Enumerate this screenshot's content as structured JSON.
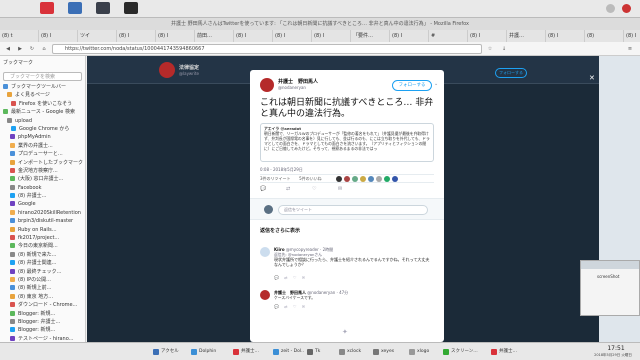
{
  "window": {
    "title": "井護士 野田馬人さんはTwitterを使っています: 「これは朝日新聞に抗議すべきところ… 非弁と真ん中の違法行為」 - Mozilla Firefox"
  },
  "tabs": [
    "(8) t",
    "(8) I",
    "ツイ",
    "(8) I",
    "(8) I",
    "前田…",
    "(8) I",
    "(8) I",
    "(8) I",
    "「要件…",
    "(8) I",
    "#",
    "(8) I",
    "井護…",
    "(8) I",
    "(8)",
    "(8) I",
    "(8) I",
    "Shor",
    "then",
    "(8) I"
  ],
  "url": "https://twitter.com/noda/status/1000441743594860667",
  "sidebar": {
    "title": "ブックマーク",
    "search_placeholder": "ブックマークを検索",
    "items": [
      "ブックマークツールバー",
      "よく見るページ",
      "Firefox を使いこなそう",
      "最新ニュース - Google 検索",
      "upload",
      "Google Chrome から",
      "phpMyAdmin",
      "業界の弁護士...",
      "プロデューサーと...",
      "インポートしたブックマーク",
      "金沢地方検察庁...",
      "(大阪) 窓口弁護士...",
      "Facebook",
      "(8) 弁護士...",
      "Google",
      "hirano2020SkillRetention",
      "brpin3/diskutil-master",
      "Ruby on Rails...",
      "fk2017/project...",
      "今日の東京新聞...",
      "(8) 新規で来た...",
      "(8) 弁護士関連...",
      "(8) 最終チェック...",
      "(8) IPの公開...",
      "(8) 新規上前...",
      "(8) 東京 地方...",
      "ダウンロード - Chrome...",
      "Blogger: 新規...",
      "Blogger: 弁護士...",
      "Blogger: 新規...",
      "テストページ - hirano...",
      "金沢市東本願寺..."
    ]
  },
  "page_header": {
    "account_name": "法律協定",
    "account_handle": "@laywrite",
    "follow_label": "フォローする"
  },
  "tweet": {
    "author_name": "井護士　野田馬人",
    "author_handle": "@nodaneryan",
    "follow_label": "フォローする",
    "text": "これは朝日新聞に抗議すべきところ… 非弁と真ん中の違法行為。",
    "quote_author": "アエイラ @aeradot",
    "quote_text": "朝日新聞で、リーガルWのプロデューサーが「監修の著名をもれて」（井護見優が最後を弁取得けず、弁判長が国際電の名事を）見に行しても、並ば行るのも、にこは立ち取りを外代しても、ドラマとしての面白さを、ドラマとしてもの面白さを流さいます。（アプリティとフィクションの間に）にご日億してみたけど。そちって、視察あるまるの非法ではっ",
    "timestamp": "0:08 - 2018年5月29日",
    "retweets_label": "3件のリツイート",
    "likes_label": "5件のいいね",
    "reply_placeholder": "返信をツイート"
  },
  "replies_header": "返信をさらに表示",
  "replies": [
    {
      "name": "Kiiro",
      "handle": "@mycopyreader · 2時間",
      "sub": "返信先: @nodaneryanさん",
      "body": "現状弁護所で相談に行ったら、弁護士を紹介されるんでるんですかね。それって大丈夫なんでしょうか？",
      "avatar_color": "#ccddee"
    },
    {
      "name": "井護士　野田馬人",
      "handle": "@nodaneryan · 47分",
      "sub": "ケースバイケースです。",
      "body": "",
      "avatar_color": "#b52a2a"
    }
  ],
  "side_pane": {
    "label": "screenShot"
  },
  "taskbar": {
    "items": [
      "アクセル",
      "Dolphin",
      "井護士…",
      "zeit - Dol…",
      "Tk",
      "xclock",
      "xeyes",
      "xlogo",
      "スクリーン…",
      "井護士…"
    ],
    "clock": "17:51",
    "date": "2018年5月29日 火曜日"
  },
  "colors": {
    "accent": "#1da1f2",
    "page_bg": "#1b2a38",
    "avatar_red": "#b52a2a"
  }
}
